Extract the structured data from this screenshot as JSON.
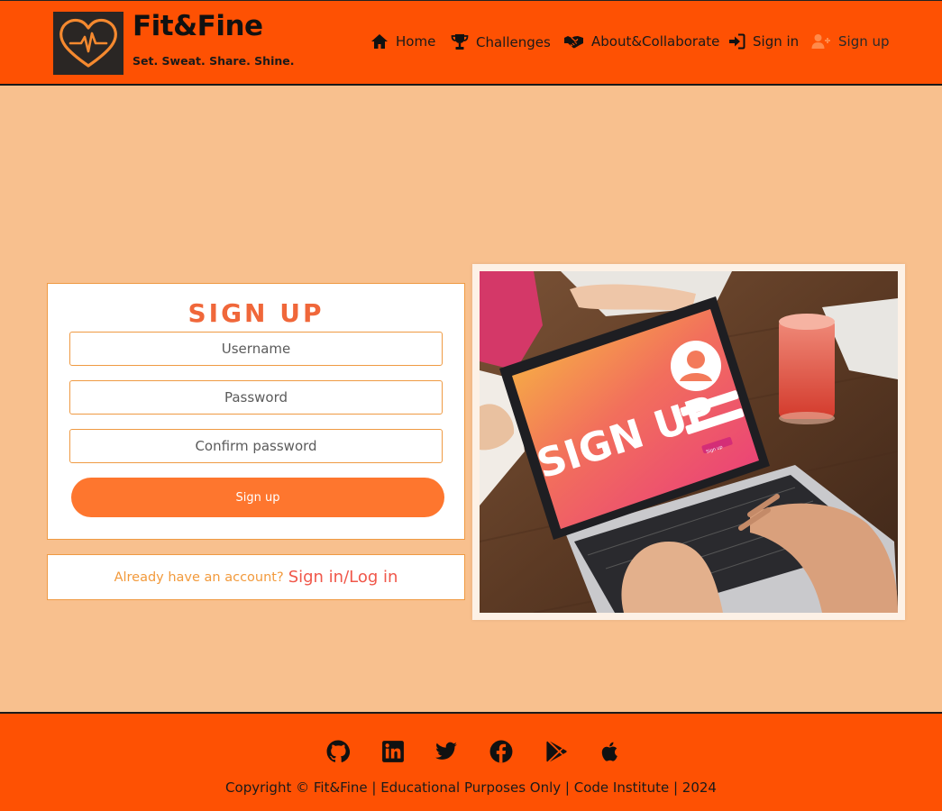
{
  "brand": {
    "name": "Fit&Fine",
    "tagline": "Set. Sweat. Share. Shine."
  },
  "nav": {
    "items": [
      {
        "label": "Home",
        "icon": "home-icon"
      },
      {
        "label": "Challenges",
        "icon": "trophy-icon"
      },
      {
        "label": "About&Collaborate",
        "icon": "handshake-icon"
      },
      {
        "label": "Sign in",
        "icon": "sign-in-icon"
      },
      {
        "label": "Sign up",
        "icon": "user-plus-icon"
      }
    ]
  },
  "signup": {
    "title": "SIGN UP",
    "username_placeholder": "Username",
    "password_placeholder": "Password",
    "confirm_placeholder": "Confirm password",
    "submit_label": "Sign up"
  },
  "login_prompt": {
    "question": "Already have an account?",
    "link": "Sign in/Log in"
  },
  "photo": {
    "screen_text": "SIGN UP",
    "button_text": "Sign up"
  },
  "footer": {
    "social": [
      "github-icon",
      "linkedin-icon",
      "twitter-icon",
      "facebook-icon",
      "google-play-icon",
      "apple-icon"
    ],
    "copyright": "Copyright © Fit&Fine | Educational Purposes Only | Code Institute | 2024"
  },
  "colors": {
    "header_bg": "#fe5103",
    "page_bg": "#f8c08e",
    "accent": "#fe762e",
    "title": "#f0673a"
  }
}
